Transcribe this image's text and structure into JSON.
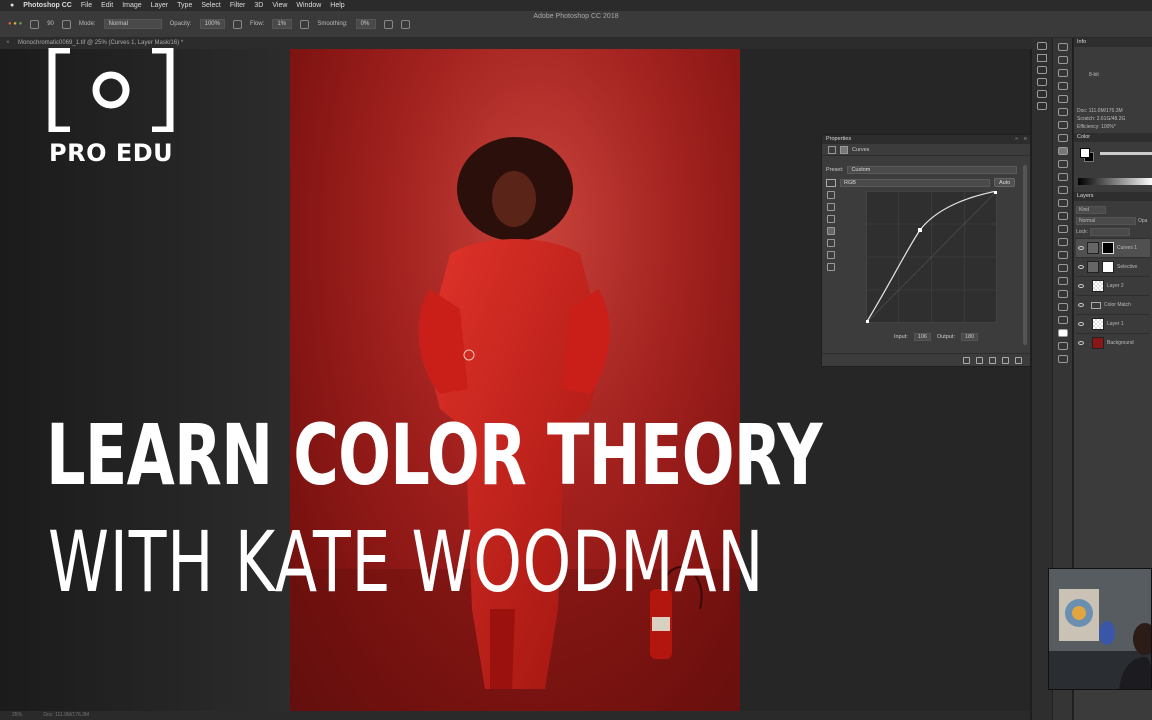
{
  "menubar": {
    "app": "Photoshop CC",
    "items": [
      "File",
      "Edit",
      "Image",
      "Layer",
      "Type",
      "Select",
      "Filter",
      "3D",
      "View",
      "Window",
      "Help"
    ],
    "window_title": "Adobe Photoshop CC 2018"
  },
  "options_bar": {
    "brush_size": "90",
    "mode_label": "Mode:",
    "mode_value": "Normal",
    "opacity_label": "Opacity:",
    "opacity_value": "100%",
    "flow_label": "Flow:",
    "flow_value": "1%",
    "smoothing_label": "Smoothing:",
    "smoothing_value": "0%"
  },
  "document_tab": {
    "label": "Monochromatic0069_1.tif @ 25% (Curves 1, Layer Mask/16) *"
  },
  "status_bar": {
    "zoom": "25%",
    "doc": "Doc: 111.0M/176.3M"
  },
  "info_panel": {
    "title": "Info",
    "bit": "8-bit",
    "doc": "Doc: 111.0M/176.3M",
    "scratch": "Scratch: 2.61G/48.2G",
    "efficiency": "Efficiency: 100%*"
  },
  "color_panel": {
    "title": "Color"
  },
  "layers_panel": {
    "title": "Layers",
    "kind": "Kind",
    "blend": "Normal",
    "opacity_label": "Opa",
    "lock_label": "Lock:",
    "layers": [
      {
        "name": "Curves 1",
        "type": "adjustment",
        "mask": "black",
        "selected": true
      },
      {
        "name": "Selective",
        "type": "adjustment",
        "mask": "white",
        "selected": false
      },
      {
        "name": "Layer 2",
        "type": "pixel",
        "selected": false
      },
      {
        "name": "Color Match",
        "type": "group",
        "selected": false
      },
      {
        "name": "Layer 1",
        "type": "pixel",
        "selected": false
      },
      {
        "name": "Background",
        "type": "background",
        "selected": false
      }
    ]
  },
  "properties_panel": {
    "title": "Properties",
    "adjustment": "Curves",
    "preset_label": "Preset:",
    "preset_value": "Custom",
    "channel": "RGB",
    "auto_button": "Auto",
    "input_label": "Input:",
    "input_value": "106",
    "output_label": "Output:",
    "output_value": "180"
  },
  "overlay": {
    "brand": "PRO EDU",
    "title_line1": "LEARN COLOR THEORY",
    "title_line2": "WITH KATE WOODMAN"
  },
  "colors": {
    "photo_red": "#a4201d",
    "panel_bg": "#3c3c3c",
    "text_white": "#ffffff"
  }
}
